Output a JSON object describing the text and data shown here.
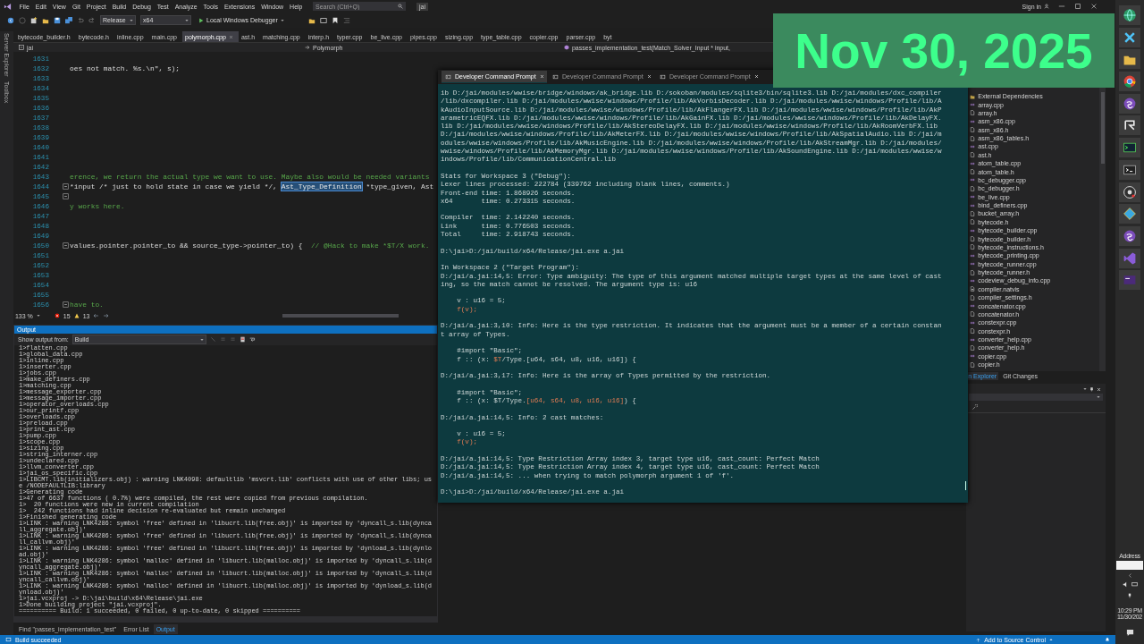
{
  "menu_bar": {
    "items": [
      "File",
      "Edit",
      "View",
      "Git",
      "Project",
      "Build",
      "Debug",
      "Test",
      "Analyze",
      "Tools",
      "Extensions",
      "Window",
      "Help"
    ],
    "search": {
      "placeholder": "Search (Ctrl+Q)"
    },
    "solution_name": "jai",
    "sign_in": "Sign in"
  },
  "toolbar": {
    "configuration": "Release",
    "platform": "x64",
    "debugger": "Local Windows Debugger"
  },
  "side_strip": [
    "Server Explorer",
    "Toolbox"
  ],
  "document_tabs": [
    {
      "label": "bytecode_builder.h",
      "selected": false
    },
    {
      "label": "bytecode.h",
      "selected": false
    },
    {
      "label": "inline.cpp",
      "selected": false
    },
    {
      "label": "main.cpp",
      "selected": false
    },
    {
      "label": "polymorph.cpp",
      "selected": true
    },
    {
      "label": "ast.h",
      "selected": false
    },
    {
      "label": "matching.cpp",
      "selected": false
    },
    {
      "label": "interp.h",
      "selected": false
    },
    {
      "label": "typer.cpp",
      "selected": false
    },
    {
      "label": "be_live.cpp",
      "selected": false
    },
    {
      "label": "pipes.cpp",
      "selected": false
    },
    {
      "label": "sizing.cpp",
      "selected": false
    },
    {
      "label": "type_table.cpp",
      "selected": false
    },
    {
      "label": "copier.cpp",
      "selected": false
    },
    {
      "label": "parser.cpp",
      "selected": false
    },
    {
      "label": "byt",
      "selected": false
    }
  ],
  "nav_bar": {
    "project": "jai",
    "class": "Polymorph",
    "member": "passes_implementation_test(Match_Solver_Input * input,"
  },
  "editor": {
    "zoom": "133 %",
    "errors": "15",
    "warnings": "13",
    "lines": [
      {
        "number": "1631",
        "foldable": false
      },
      {
        "number": "1632",
        "foldable": false,
        "parts": [
          {
            "text": "oes not match. %s.\\n\", s);",
            "kind": "code"
          }
        ]
      },
      {
        "number": "1633",
        "foldable": false
      },
      {
        "number": "1634",
        "foldable": false
      },
      {
        "number": "1635",
        "foldable": false
      },
      {
        "number": "1636",
        "foldable": false
      },
      {
        "number": "1637",
        "foldable": false
      },
      {
        "number": "1638",
        "foldable": false
      },
      {
        "number": "1639",
        "foldable": false
      },
      {
        "number": "1640",
        "foldable": false
      },
      {
        "number": "1641",
        "foldable": false
      },
      {
        "number": "1642",
        "foldable": false
      },
      {
        "number": "1643",
        "foldable": false,
        "parts": [
          {
            "text": "erence, we return the actual type we want to use. Maybe also would be needed variants",
            "kind": "comment"
          }
        ]
      },
      {
        "number": "1644",
        "foldable": true,
        "parts": [
          {
            "text": "*input /* just to hold state in case we yield */, ",
            "kind": "code"
          },
          {
            "text": "Ast_Type_Definition",
            "kind": "selection"
          },
          {
            "text": " *type_given, Ast",
            "kind": "code"
          }
        ]
      },
      {
        "number": "1645",
        "foldable": true
      },
      {
        "number": "1646",
        "foldable": false,
        "parts": [
          {
            "text": "y works here.",
            "kind": "comment"
          }
        ]
      },
      {
        "number": "1647",
        "foldable": false
      },
      {
        "number": "1648",
        "foldable": false
      },
      {
        "number": "1649",
        "foldable": false
      },
      {
        "number": "1650",
        "foldable": true,
        "parts": [
          {
            "text": "values.pointer.pointer_to && source_type->pointer_to) {  ",
            "kind": "code"
          },
          {
            "text": "// @Hack to make *$T/X work.",
            "kind": "comment"
          }
        ]
      },
      {
        "number": "1651",
        "foldable": false
      },
      {
        "number": "1652",
        "foldable": false
      },
      {
        "number": "1653",
        "foldable": false
      },
      {
        "number": "1654",
        "foldable": false
      },
      {
        "number": "1655",
        "foldable": false
      },
      {
        "number": "1656",
        "foldable": true,
        "parts": [
          {
            "text": "have to.",
            "kind": "comment"
          }
        ]
      }
    ]
  },
  "output": {
    "title": "Output",
    "source_label": "Show output from:",
    "source": "Build",
    "lines": [
      "1>flatten.cpp",
      "1>global_data.cpp",
      "1>inline.cpp",
      "1>inserter.cpp",
      "1>jobs.cpp",
      "1>make_definers.cpp",
      "1>matching.cpp",
      "1>message_exporter.cpp",
      "1>message_importer.cpp",
      "1>operator_overloads.cpp",
      "1>our_printf.cpp",
      "1>overloads.cpp",
      "1>preload.cpp",
      "1>print_ast.cpp",
      "1>pump.cpp",
      "1>scope.cpp",
      "1>sizing.cpp",
      "1>string_interner.cpp",
      "1>undeclared.cpp",
      "1>llvm_converter.cpp",
      "1>jai_os_specific.cpp",
      "1>LIBCMT.lib(initializers.obj) : warning LNK4098: defaultlib 'msvcrt.lib' conflicts with use of other libs; use /NODEFAULTLIB:library",
      "1>Generating code",
      "1>47 of 6637 functions ( 0.7%) were compiled, the rest were copied from previous compilation.",
      "1>  20 functions were new in current compilation",
      "1>  242 functions had inline decision re-evaluated but remain unchanged",
      "1>Finished generating code",
      "1>LINK : warning LNK4286: symbol 'free' defined in 'libucrt.lib(free.obj)' is imported by 'dyncall_s.lib(dyncall_aggregate.obj)'",
      "1>LINK : warning LNK4286: symbol 'free' defined in 'libucrt.lib(free.obj)' is imported by 'dyncall_s.lib(dyncall_callvm.obj)'",
      "1>LINK : warning LNK4286: symbol 'free' defined in 'libucrt.lib(free.obj)' is imported by 'dynload_s.lib(dynload.obj)'",
      "1>LINK : warning LNK4286: symbol 'malloc' defined in 'libucrt.lib(malloc.obj)' is imported by 'dyncall_s.lib(dyncall_aggregate.obj)'",
      "1>LINK : warning LNK4286: symbol 'malloc' defined in 'libucrt.lib(malloc.obj)' is imported by 'dyncall_s.lib(dyncall_callvm.obj)'",
      "1>LINK : warning LNK4286: symbol 'malloc' defined in 'libucrt.lib(malloc.obj)' is imported by 'dynload_s.lib(dynload.obj)'",
      "1>jai.vcxproj -> D:\\jai\\build\\x64\\Release\\jai.exe",
      "1>Done building project \"jai.vcxproj\".",
      "========== Build: 1 succeeded, 0 failed, 0 up-to-date, 0 skipped =========="
    ]
  },
  "bottom_tabs": [
    {
      "label": "Find \"passes_implementation_test\"",
      "selected": false
    },
    {
      "label": "Error List",
      "selected": false
    },
    {
      "label": "Output",
      "selected": true
    }
  ],
  "console": {
    "tabs": [
      {
        "label": "Developer Command Prompt",
        "selected": true
      },
      {
        "label": "Developer Command Prompt",
        "selected": false
      },
      {
        "label": "Developer Command Prompt",
        "selected": false
      }
    ],
    "blocks": [
      {
        "lines": [
          "ib D:/jai/modules/wwise/bridge/windows/ak_bridge.lib D:/sokoban/modules/sqlite3/bin/sqlite3.lib D:/jai/modules/dxc_compiler",
          "/lib/dxcompiler.lib D:/jai/modules/wwise/windows/Profile/lib/AkVorbisDecoder.lib D:/jai/modules/wwise/windows/Profile/lib/A",
          "kAudioInputSource.lib D:/jai/modules/wwise/windows/Profile/lib/AkFlangerFX.lib D:/jai/modules/wwise/windows/Profile/lib/AkP",
          "arametricEQFX.lib D:/jai/modules/wwise/windows/Profile/lib/AkGainFX.lib D:/jai/modules/wwise/windows/Profile/lib/AkDelayFX.",
          "lib D:/jai/modules/wwise/windows/Profile/lib/AkStereoDelayFX.lib D:/jai/modules/wwise/windows/Profile/lib/AkRoomVerbFX.lib",
          "D:/jai/modules/wwise/windows/Profile/lib/AkMeterFX.lib D:/jai/modules/wwise/windows/Profile/lib/AkSpatialAudio.lib D:/jai/m",
          "odules/wwise/windows/Profile/lib/AkMusicEngine.lib D:/jai/modules/wwise/windows/Profile/lib/AkStreamMgr.lib D:/jai/modules/",
          "wwise/windows/Profile/lib/AkMemoryMgr.lib D:/jai/modules/wwise/windows/Profile/lib/AkSoundEngine.lib D:/jai/modules/wwise/w",
          "indows/Profile/lib/CommunicationCentral.lib"
        ]
      },
      {
        "lines": [
          "Stats for Workspace 3 (\"Debug\"):",
          "Lexer lines processed: 222784 (339762 including blank lines, comments.)",
          "Front-end time: 1.868926 seconds.",
          "x64       time: 0.273315 seconds."
        ]
      },
      {
        "lines": [
          "Compiler  time: 2.142240 seconds.",
          "Link      time: 0.776503 seconds.",
          "Total     time: 2.918743 seconds."
        ]
      },
      {
        "lines": [
          "D:\\jai>D:/jai/build/x64/Release/jai.exe a.jai"
        ]
      },
      {
        "lines": [
          "In Workspace 2 (\"Target Program\"):",
          "D:/jai/a.jai:14,5: Error: Type ambiguity: The type of this argument matched multiple target types at the same level of cast",
          "ing, so the match cannot be resolved. The argument type is: u16"
        ]
      },
      {
        "lines": [
          "    v : u16 = 5;",
          {
            "parts": [
              {
                "text": "    f(v);",
                "hl": true
              }
            ]
          }
        ]
      },
      {
        "lines": [
          "D:/jai/a.jai:3,10: Info: Here is the type restriction. It indicates that the argument must be a member of a certain constan",
          "t array of Types."
        ]
      },
      {
        "lines": [
          "    #import \"Basic\";",
          {
            "parts": [
              {
                "text": "    f :: (x: ",
                "hl": false
              },
              {
                "text": "$T",
                "hl": true
              },
              {
                "text": "/Type.[u64, s64, u8, u16, u16]) {",
                "hl": false
              }
            ]
          }
        ]
      },
      {
        "lines": [
          "D:/jai/a.jai:3,17: Info: Here is the array of Types permitted by the restriction."
        ]
      },
      {
        "lines": [
          "    #import \"Basic\";",
          {
            "parts": [
              {
                "text": "    f :: (x: $T/Type.",
                "hl": false
              },
              {
                "text": "[u64, s64, u8, u16, u16]",
                "hl": true
              },
              {
                "text": ") {",
                "hl": false
              }
            ]
          }
        ]
      },
      {
        "lines": [
          "D:/jai/a.jai:14,5: Info: 2 cast matches:"
        ]
      },
      {
        "lines": [
          "    v : u16 = 5;",
          {
            "parts": [
              {
                "text": "    f(v);",
                "hl": true
              }
            ]
          }
        ]
      },
      {
        "lines": [
          "D:/jai/a.jai:14,5: Type Restriction Array index 3, target type u16, cast_count: Perfect Match",
          "D:/jai/a.jai:14,5: Type Restriction Array index 4, target type u16, cast_count: Perfect Match",
          "D:/jai/a.jai:14,5: ... when trying to match polymorph argument 1 of 'f'."
        ]
      },
      {
        "lines": [
          "D:\\jai>D:/jai/build/x64/Release/jai.exe a.jai"
        ]
      }
    ]
  },
  "solution_explorer": {
    "items": [
      {
        "name": "External Dependencies",
        "kind": "folder"
      },
      {
        "name": "array.cpp",
        "kind": "source"
      },
      {
        "name": "array.h",
        "kind": "header"
      },
      {
        "name": "asm_x86.cpp",
        "kind": "source"
      },
      {
        "name": "asm_x86.h",
        "kind": "header"
      },
      {
        "name": "asm_x86_tables.h",
        "kind": "header"
      },
      {
        "name": "ast.cpp",
        "kind": "source"
      },
      {
        "name": "ast.h",
        "kind": "header"
      },
      {
        "name": "atom_table.cpp",
        "kind": "source"
      },
      {
        "name": "atom_table.h",
        "kind": "header"
      },
      {
        "name": "bc_debugger.cpp",
        "kind": "source"
      },
      {
        "name": "bc_debugger.h",
        "kind": "header"
      },
      {
        "name": "be_live.cpp",
        "kind": "source"
      },
      {
        "name": "bind_definers.cpp",
        "kind": "source"
      },
      {
        "name": "bucket_array.h",
        "kind": "header"
      },
      {
        "name": "bytecode.h",
        "kind": "header"
      },
      {
        "name": "bytecode_builder.cpp",
        "kind": "source"
      },
      {
        "name": "bytecode_builder.h",
        "kind": "header"
      },
      {
        "name": "bytecode_instructions.h",
        "kind": "header"
      },
      {
        "name": "bytecode_printing.cpp",
        "kind": "source"
      },
      {
        "name": "bytecode_runner.cpp",
        "kind": "source"
      },
      {
        "name": "bytecode_runner.h",
        "kind": "header"
      },
      {
        "name": "codeview_debug_info.cpp",
        "kind": "source"
      },
      {
        "name": "compiler.natvis",
        "kind": "natvis"
      },
      {
        "name": "compiler_settings.h",
        "kind": "header"
      },
      {
        "name": "concatenator.cpp",
        "kind": "source"
      },
      {
        "name": "concatenator.h",
        "kind": "header"
      },
      {
        "name": "constexpr.cpp",
        "kind": "source"
      },
      {
        "name": "constexpr.h",
        "kind": "header"
      },
      {
        "name": "converter_help.cpp",
        "kind": "source"
      },
      {
        "name": "converter_help.h",
        "kind": "header"
      },
      {
        "name": "copier.cpp",
        "kind": "source"
      },
      {
        "name": "copier.h",
        "kind": "header"
      }
    ],
    "tabs": [
      {
        "label": "n Explorer",
        "selected": true
      },
      {
        "label": "Git Changes",
        "selected": false
      }
    ]
  },
  "status_bar": {
    "message": "Build succeeded",
    "source_control": "Add to Source Control"
  },
  "taskbar": {
    "address_label": "Address",
    "time": "10:29 PM",
    "date": "11/30/202"
  },
  "date_overlay": "Nov 30, 2025"
}
